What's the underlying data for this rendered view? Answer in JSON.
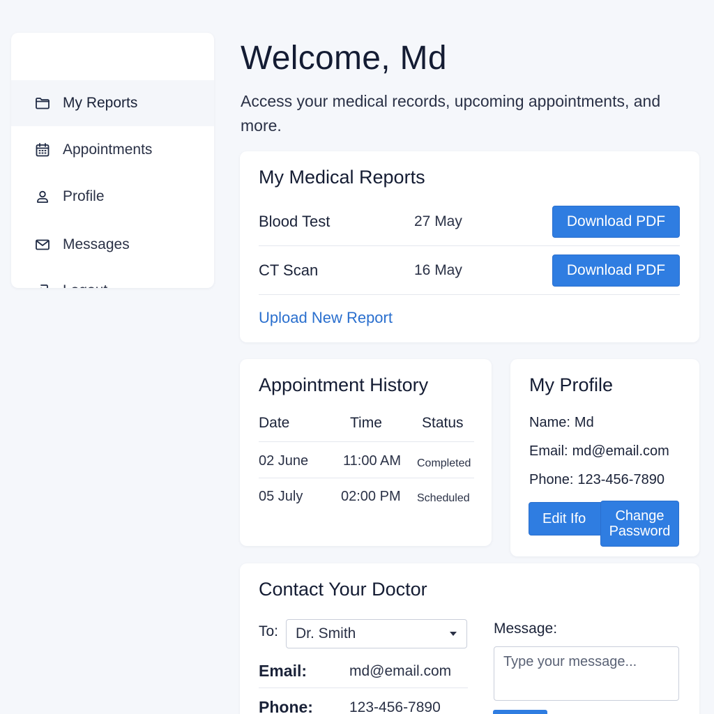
{
  "sidebar": {
    "items": [
      {
        "label": "My Reports",
        "icon": "folder-icon",
        "active": true
      },
      {
        "label": "Appointments",
        "icon": "calendar-icon",
        "active": false
      },
      {
        "label": "Profile",
        "icon": "user-icon",
        "active": false
      },
      {
        "label": "Messages",
        "icon": "mail-icon",
        "active": false
      },
      {
        "label": "Logout",
        "icon": "logout-icon",
        "active": false
      }
    ]
  },
  "header": {
    "title": "Welcome, Md",
    "subtitle": "Access your medical records, upcoming appointments, and more."
  },
  "reports": {
    "title": "My Medical Reports",
    "rows": [
      {
        "name": "Blood Test",
        "date": "27 May",
        "action": "Download PDF"
      },
      {
        "name": "CT Scan",
        "date": "16 May",
        "action": "Download PDF"
      }
    ],
    "upload_label": "Upload New Report"
  },
  "appointments": {
    "title": "Appointment History",
    "columns": [
      "Date",
      "Time",
      "Status"
    ],
    "rows": [
      {
        "date": "02 June",
        "time": "11:00 AM",
        "status": "Completed"
      },
      {
        "date": "05 July",
        "time": "02:00 PM",
        "status": "Scheduled"
      }
    ]
  },
  "profile": {
    "title": "My Profile",
    "name_label": "Name:",
    "name": "Md",
    "email_label": "Email:",
    "email": "md@email.com",
    "phone_label": "Phone:",
    "phone": "123-456-7890",
    "edit_label": "Edit Ifo",
    "change_password_line1": "Change",
    "change_password_line2": "Password"
  },
  "contact": {
    "title": "Contact Your Doctor",
    "to_label": "To:",
    "doctor": "Dr. Smith",
    "email_label": "Email:",
    "email": "md@email.com",
    "phone_label": "Phone:",
    "phone": "123-456-7890",
    "message_label": "Message:",
    "message_placeholder": "Type your message..."
  },
  "colors": {
    "primary": "#2f7de1",
    "link": "#2a6fce",
    "background": "#f5f7fb",
    "text": "#1a2238"
  }
}
